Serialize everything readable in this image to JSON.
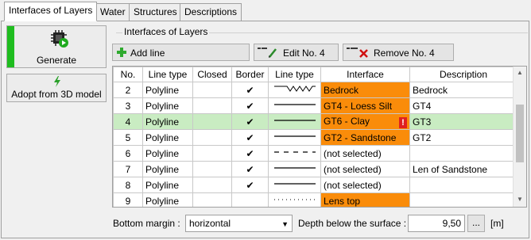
{
  "tabs": [
    {
      "label": "Interfaces of Layers"
    },
    {
      "label": "Water"
    },
    {
      "label": "Structures"
    },
    {
      "label": "Descriptions"
    }
  ],
  "left": {
    "generate_label": "Generate",
    "adopt_label": "Adopt from 3D model"
  },
  "group_title": "Interfaces of Layers",
  "toolbar": {
    "add_label": "Add line",
    "edit_label": "Edit No. 4",
    "remove_label": "Remove No. 4"
  },
  "table": {
    "headers": [
      "No.",
      "Line type",
      "Closed",
      "Border",
      "Line type",
      "Interface",
      "Description"
    ],
    "rows": [
      {
        "no": "2",
        "line_type": "Polyline",
        "closed": "",
        "border": "✔",
        "pattern": "zigzag",
        "interface": "Bedrock",
        "orange": true,
        "description": "Bedrock",
        "selected": false,
        "warning": false
      },
      {
        "no": "3",
        "line_type": "Polyline",
        "closed": "",
        "border": "✔",
        "pattern": "solid",
        "interface": "GT4 - Loess Silt",
        "orange": true,
        "description": "GT4",
        "selected": false,
        "warning": false
      },
      {
        "no": "4",
        "line_type": "Polyline",
        "closed": "",
        "border": "✔",
        "pattern": "solid",
        "interface": "GT6 - Clay",
        "orange": true,
        "description": "GT3",
        "selected": true,
        "warning": true
      },
      {
        "no": "5",
        "line_type": "Polyline",
        "closed": "",
        "border": "✔",
        "pattern": "solid",
        "interface": "GT2 - Sandstone",
        "orange": true,
        "description": "GT2",
        "selected": false,
        "warning": false
      },
      {
        "no": "6",
        "line_type": "Polyline",
        "closed": "",
        "border": "✔",
        "pattern": "dashed",
        "interface": "(not selected)",
        "orange": false,
        "description": "",
        "selected": false,
        "warning": false
      },
      {
        "no": "7",
        "line_type": "Polyline",
        "closed": "",
        "border": "✔",
        "pattern": "solid",
        "interface": "(not selected)",
        "orange": false,
        "description": "Len of Sandstone",
        "selected": false,
        "warning": false
      },
      {
        "no": "8",
        "line_type": "Polyline",
        "closed": "",
        "border": "✔",
        "pattern": "solid",
        "interface": "(not selected)",
        "orange": false,
        "description": "",
        "selected": false,
        "warning": false
      },
      {
        "no": "9",
        "line_type": "Polyline",
        "closed": "",
        "border": "",
        "pattern": "dotted",
        "interface": "Lens top",
        "orange": true,
        "description": "",
        "selected": false,
        "warning": false
      }
    ]
  },
  "bottom": {
    "margin_label": "Bottom margin :",
    "margin_value": "horizontal",
    "depth_label": "Depth below the surface :",
    "depth_value": "9,50",
    "dots": "...",
    "unit": "[m]"
  },
  "colors": {
    "orange": "#fa8c0a",
    "selected_row": "#c9ecc2",
    "green_stripe": "#1fbd1f",
    "warning_red": "#e02020"
  }
}
